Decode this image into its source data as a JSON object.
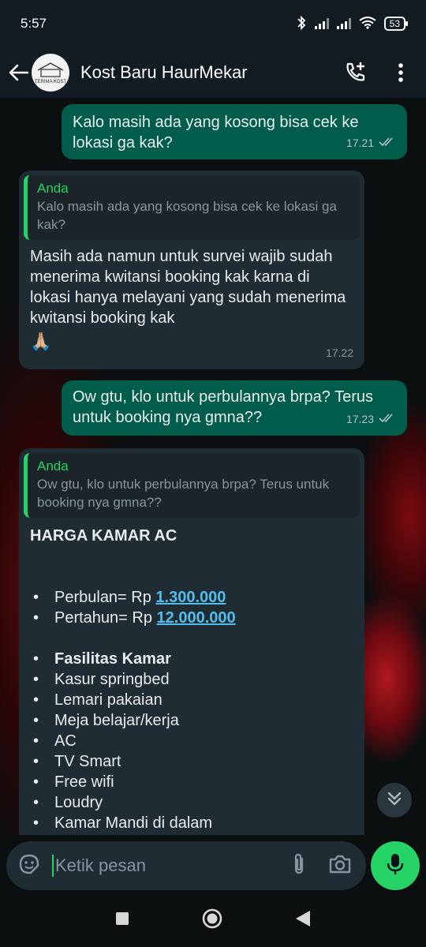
{
  "status": {
    "time": "5:57",
    "battery": "53"
  },
  "header": {
    "title": "Kost Baru HaurMekar",
    "avatar_text": "TERIMA KOST"
  },
  "messages": {
    "m1": {
      "text": "Kalo masih ada yang kosong bisa cek ke lokasi ga kak?",
      "time": "17.21"
    },
    "m2": {
      "quote_name": "Anda",
      "quote_text": "Kalo masih ada yang kosong bisa cek ke lokasi ga kak?",
      "text": "Masih ada namun untuk survei wajib sudah menerima kwitansi booking kak karna di lokasi hanya melayani yang sudah menerima kwitansi booking kak",
      "emoji": "🙏🏼",
      "time": "17.22"
    },
    "m3": {
      "text": "Ow gtu, klo untuk perbulannya brpa? Terus untuk booking nya gmna??",
      "time": "17.23"
    },
    "m4": {
      "quote_name": "Anda",
      "quote_text": "Ow gtu, klo untuk perbulannya brpa? Terus untuk booking nya gmna??",
      "heading": "HARGA KAMAR AC",
      "prices": [
        {
          "label": "Perbulan= Rp ",
          "value": "1.300.000"
        },
        {
          "label": "Pertahun= Rp ",
          "value": "12.000.000"
        }
      ],
      "facilities_title": "Fasilitas Kamar",
      "facilities": [
        "Kasur springbed",
        "Lemari pakaian",
        "Meja belajar/kerja",
        "AC",
        "TV Smart",
        "Free wifi",
        "Loudry",
        "Kamar Mandi di dalam"
      ]
    }
  },
  "composer": {
    "placeholder": "Ketik pesan"
  },
  "colors": {
    "outgoing": "#005c4b",
    "incoming": "#202c33",
    "accent": "#25d366",
    "link": "#53bdeb"
  }
}
